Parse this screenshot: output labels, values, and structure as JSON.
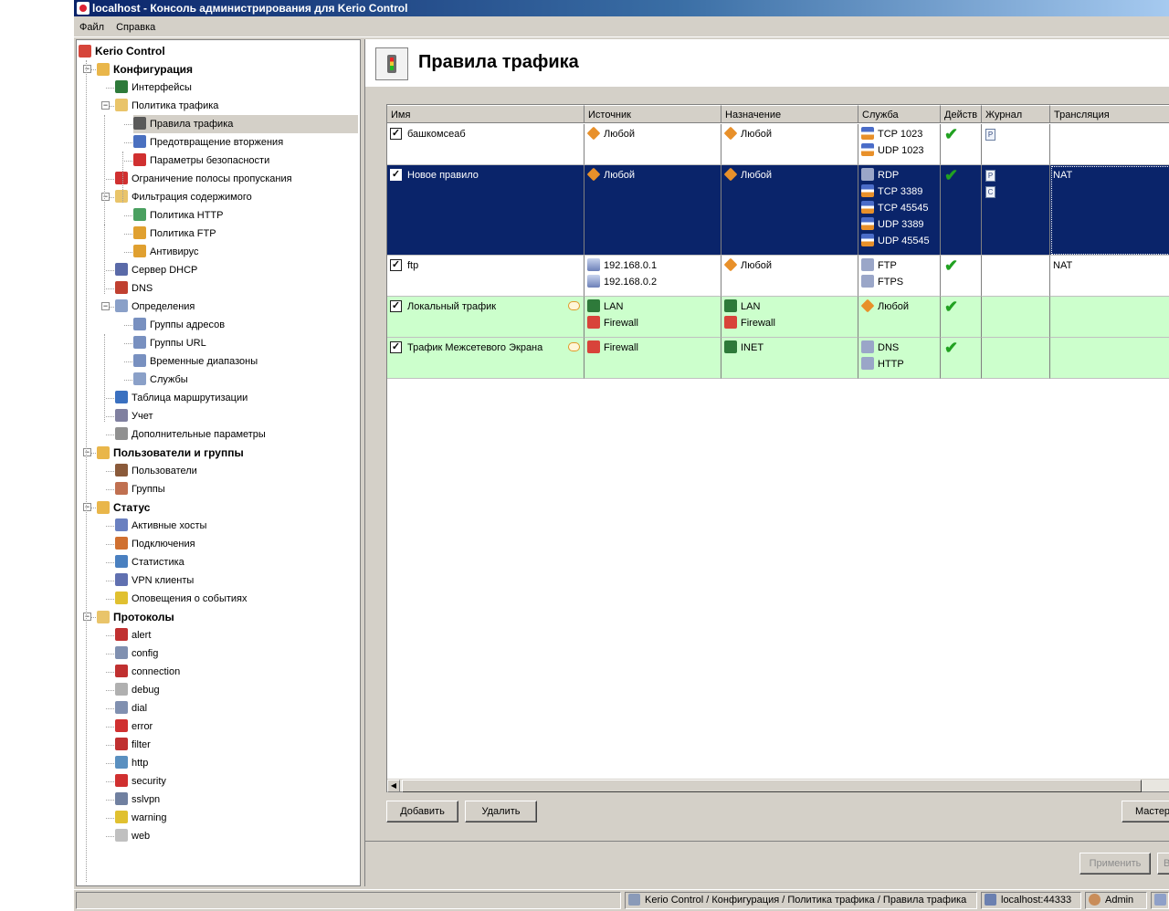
{
  "window": {
    "title": "localhost - Консоль администрирования для Kerio Control"
  },
  "menu": [
    "Файл",
    "Справка"
  ],
  "tree": [
    {
      "label": "Kerio Control",
      "bold": true,
      "icon": "kerio-logo-icon"
    },
    {
      "label": "Конфигурация",
      "bold": true,
      "icon": "folder-config-icon"
    },
    {
      "label": "Интерфейсы",
      "icon": "network-card-icon"
    },
    {
      "label": "Политика трафика",
      "icon": "folder-icon"
    },
    {
      "label": "Правила трафика",
      "icon": "traffic-light-icon",
      "selected": true
    },
    {
      "label": "Предотвращение вторжения",
      "icon": "shield-icon"
    },
    {
      "label": "Параметры безопасности",
      "icon": "security-icon"
    },
    {
      "label": "Ограничение полосы пропускания",
      "icon": "bandwidth-icon"
    },
    {
      "label": "Фильтрация содержимого",
      "icon": "folder-icon"
    },
    {
      "label": "Политика HTTP",
      "icon": "http-policy-icon"
    },
    {
      "label": "Политика FTP",
      "icon": "ftp-policy-icon"
    },
    {
      "label": "Антивирус",
      "icon": "antivirus-icon"
    },
    {
      "label": "Сервер DHCP",
      "icon": "dhcp-icon"
    },
    {
      "label": "DNS",
      "icon": "dns-icon"
    },
    {
      "label": "Определения",
      "icon": "definitions-icon"
    },
    {
      "label": "Группы адресов",
      "icon": "address-groups-icon"
    },
    {
      "label": "Группы URL",
      "icon": "url-groups-icon"
    },
    {
      "label": "Временные диапазоны",
      "icon": "time-ranges-icon"
    },
    {
      "label": "Службы",
      "icon": "services-icon"
    },
    {
      "label": "Таблица маршрутизации",
      "icon": "routing-icon"
    },
    {
      "label": "Учет",
      "icon": "accounting-icon"
    },
    {
      "label": "Дополнительные параметры",
      "icon": "advanced-options-icon"
    },
    {
      "label": "Пользователи и группы",
      "bold": true,
      "icon": "users-folder-icon"
    },
    {
      "label": "Пользователи",
      "icon": "user-icon"
    },
    {
      "label": "Группы",
      "icon": "group-icon"
    },
    {
      "label": "Статус",
      "bold": true,
      "icon": "status-folder-icon"
    },
    {
      "label": "Активные хосты",
      "icon": "active-hosts-icon"
    },
    {
      "label": "Подключения",
      "icon": "connections-icon"
    },
    {
      "label": "Статистика",
      "icon": "statistics-icon"
    },
    {
      "label": "VPN клиенты",
      "icon": "vpn-clients-icon"
    },
    {
      "label": "Оповещения о событиях",
      "icon": "warning-icon"
    },
    {
      "label": "Протоколы",
      "bold": true,
      "icon": "logs-folder-icon"
    },
    {
      "label": "alert",
      "icon": "alert-log-icon"
    },
    {
      "label": "config",
      "icon": "config-log-icon"
    },
    {
      "label": "connection",
      "icon": "connection-log-icon"
    },
    {
      "label": "debug",
      "icon": "debug-log-icon"
    },
    {
      "label": "dial",
      "icon": "dial-log-icon"
    },
    {
      "label": "error",
      "icon": "error-log-icon"
    },
    {
      "label": "filter",
      "icon": "filter-log-icon"
    },
    {
      "label": "http",
      "icon": "http-log-icon"
    },
    {
      "label": "security",
      "icon": "security-log-icon"
    },
    {
      "label": "sslvpn",
      "icon": "sslvpn-log-icon"
    },
    {
      "label": "warning",
      "icon": "warning-log-icon"
    },
    {
      "label": "web",
      "icon": "web-log-icon"
    }
  ],
  "page": {
    "title": "Правила трафика"
  },
  "table": {
    "columns": [
      "Имя",
      "Источник",
      "Назначение",
      "Служба",
      "Действ",
      "Журнал",
      "Трансляция"
    ],
    "rows": [
      {
        "name": "башкомсеаб",
        "checked": true,
        "comment": false,
        "source": [
          {
            "text": "Любой",
            "icon": "any"
          }
        ],
        "destination": [
          {
            "text": "Любой",
            "icon": "any"
          }
        ],
        "service": [
          {
            "text": "TCP 1023",
            "icon": "port"
          },
          {
            "text": "UDP 1023",
            "icon": "port"
          }
        ],
        "action": "allow",
        "log": [
          "P"
        ],
        "translation": "",
        "style": "white"
      },
      {
        "name": "Новое правило",
        "checked": true,
        "comment": false,
        "source": [
          {
            "text": "Любой",
            "icon": "any"
          }
        ],
        "destination": [
          {
            "text": "Любой",
            "icon": "any"
          }
        ],
        "service": [
          {
            "text": "RDP",
            "icon": "svc"
          },
          {
            "text": "TCP 3389",
            "icon": "port"
          },
          {
            "text": "TCP 45545",
            "icon": "port"
          },
          {
            "text": "UDP 3389",
            "icon": "port"
          },
          {
            "text": "UDP 45545",
            "icon": "port"
          }
        ],
        "action": "allow",
        "log": [
          "P",
          "C"
        ],
        "translation": "NAT",
        "style": "selected"
      },
      {
        "name": "ftp",
        "checked": true,
        "comment": false,
        "source": [
          {
            "text": "192.168.0.1",
            "icon": "host"
          },
          {
            "text": "192.168.0.2",
            "icon": "host"
          }
        ],
        "destination": [
          {
            "text": "Любой",
            "icon": "any"
          }
        ],
        "service": [
          {
            "text": "FTP",
            "icon": "svc"
          },
          {
            "text": "FTPS",
            "icon": "svc"
          }
        ],
        "action": "allow",
        "log": [],
        "translation": "NAT",
        "style": "white"
      },
      {
        "name": "Локальный трафик",
        "checked": true,
        "comment": true,
        "source": [
          {
            "text": "LAN",
            "icon": "lan"
          },
          {
            "text": "Firewall",
            "icon": "fw"
          }
        ],
        "destination": [
          {
            "text": "LAN",
            "icon": "lan"
          },
          {
            "text": "Firewall",
            "icon": "fw"
          }
        ],
        "service": [
          {
            "text": "Любой",
            "icon": "any"
          }
        ],
        "action": "allow",
        "log": [],
        "translation": "",
        "style": "green"
      },
      {
        "name": "Трафик Межсетевого Экрана",
        "checked": true,
        "comment": true,
        "source": [
          {
            "text": "Firewall",
            "icon": "fw"
          }
        ],
        "destination": [
          {
            "text": "INET",
            "icon": "lan"
          }
        ],
        "service": [
          {
            "text": "DNS",
            "icon": "svc"
          },
          {
            "text": "HTTP",
            "icon": "svc"
          }
        ],
        "action": "allow",
        "log": [],
        "translation": "",
        "style": "green"
      }
    ]
  },
  "buttons": {
    "add": "Добавить",
    "remove": "Удалить",
    "wizard": "Мастер",
    "apply": "Применить",
    "revert": "Во"
  },
  "statusbar": {
    "path": "Kerio Control / Конфигурация / Политика трафика / Правила трафика",
    "server": "localhost:44333",
    "user": "Admin"
  },
  "colors": {
    "selected_row": "#0a246a",
    "green_row": "#ccffcc",
    "tree_selection": "#d4d0c8"
  }
}
